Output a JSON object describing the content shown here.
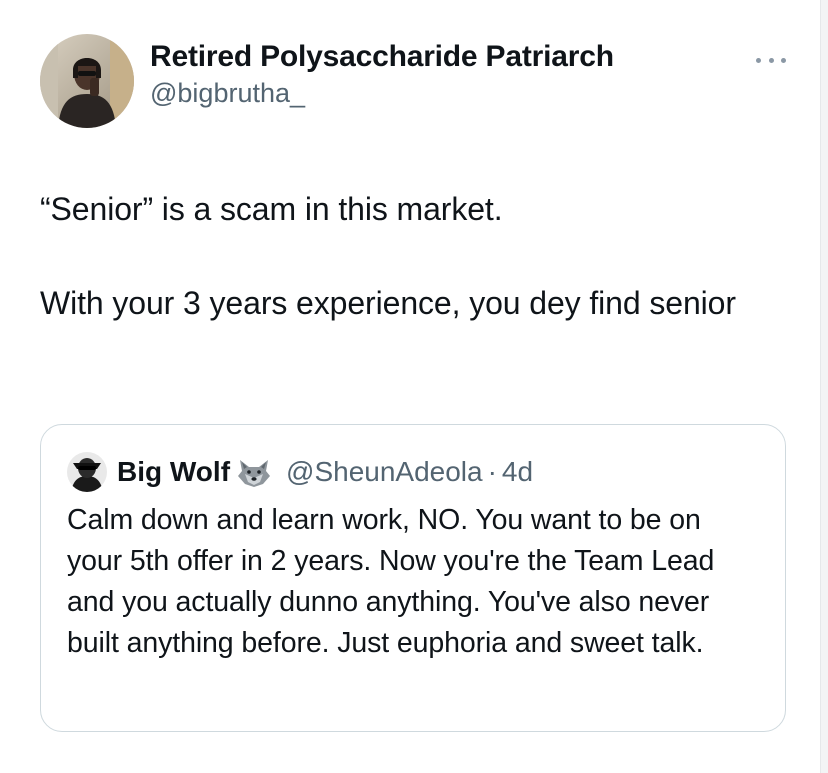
{
  "tweet": {
    "display_name": "Retired Polysaccharide Patriarch",
    "handle": "@bigbrutha_",
    "text": "“Senior” is a scam in this market.\n\nWith your 3 years experience, you dey find senior",
    "more_icon": "more-horizontal-icon"
  },
  "quoted_tweet": {
    "display_name": "Big Wolf",
    "emoji_icon": "wolf-emoji-icon",
    "handle": "@SheunAdeola",
    "separator": "·",
    "time": "4d",
    "text": "Calm down and learn work, NO. You want to be on your 5th offer in 2 years. Now you're the Team Lead and you actually dunno anything. You've also never built anything before. Just euphoria and sweet talk."
  },
  "colors": {
    "text": "#0f1419",
    "secondary_text": "#536471",
    "border": "#cfd9de"
  }
}
